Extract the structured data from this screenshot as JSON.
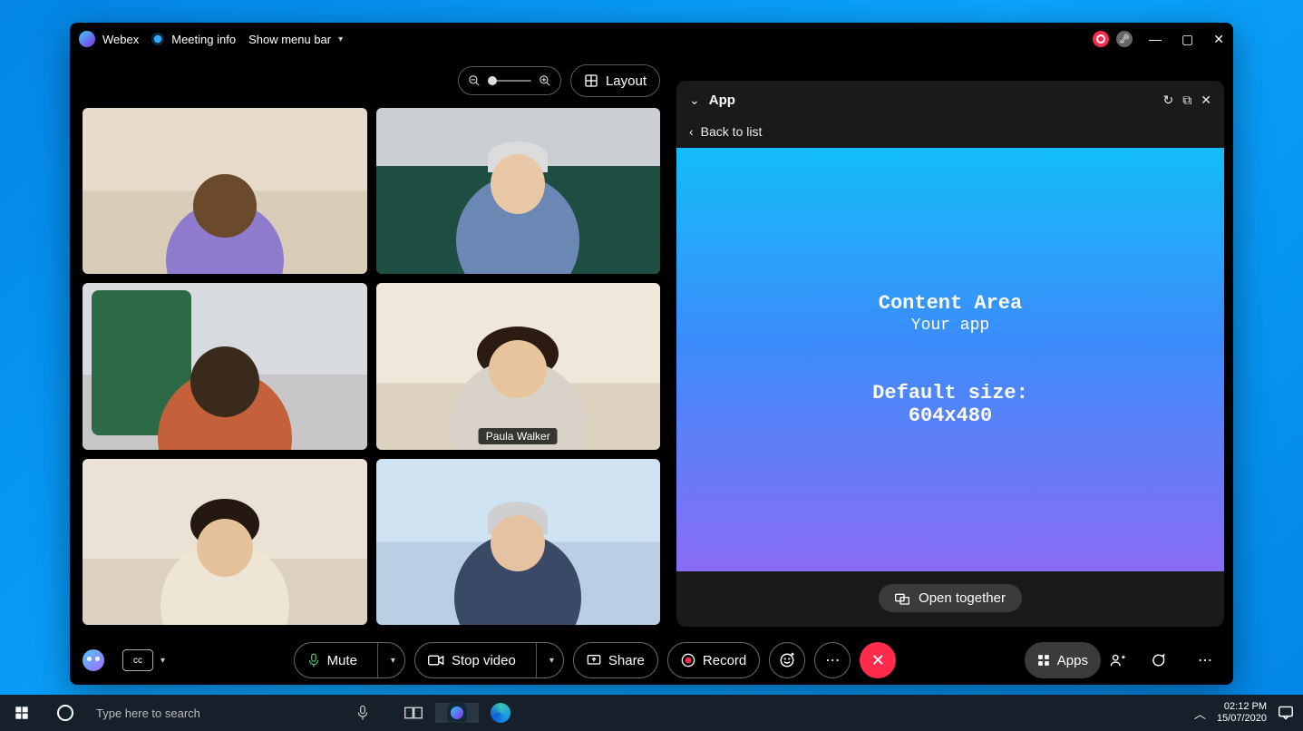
{
  "titlebar": {
    "app_name": "Webex",
    "meeting_info": "Meeting info",
    "show_menu": "Show menu bar"
  },
  "top": {
    "layout": "Layout"
  },
  "participants": [
    {
      "name": ""
    },
    {
      "name": ""
    },
    {
      "name": ""
    },
    {
      "name": "Paula Walker",
      "active": true
    },
    {
      "name": ""
    },
    {
      "name": ""
    }
  ],
  "panel": {
    "title": "App",
    "back": "Back to list",
    "content_title": "Content Area",
    "content_sub": "Your app",
    "size_label": "Default size:",
    "size_value": "604x480",
    "open_together": "Open together"
  },
  "controls": {
    "mute": "Mute",
    "stop_video": "Stop video",
    "share": "Share",
    "record": "Record",
    "apps": "Apps"
  },
  "taskbar": {
    "search_placeholder": "Type here to search",
    "time": "02:12 PM",
    "date": "15/07/2020"
  }
}
